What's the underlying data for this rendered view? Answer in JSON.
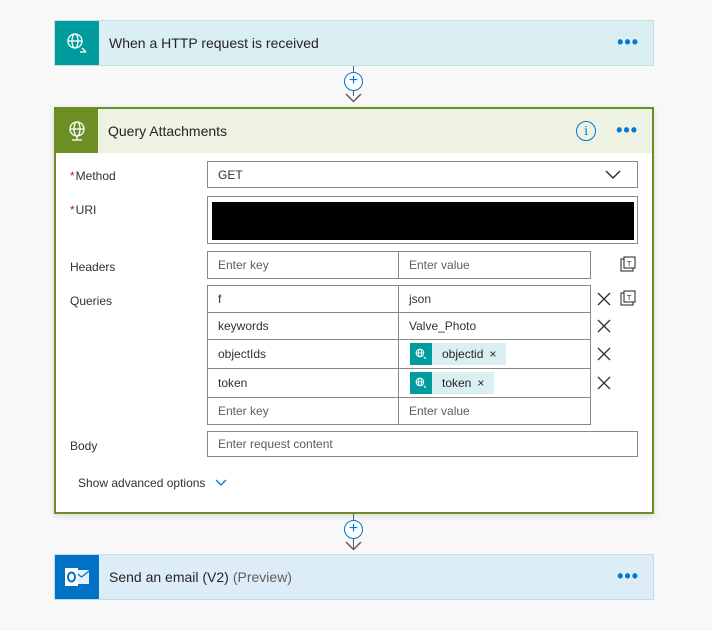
{
  "trigger": {
    "title": "When a HTTP request is received",
    "icon": "globe-http-icon",
    "color": "#009b9c",
    "more": "•••"
  },
  "action": {
    "title": "Query Attachments",
    "icon": "globe-http-icon",
    "color": "#6c8f25",
    "info": "i",
    "more": "•••",
    "method": {
      "label": "Method",
      "required": "*",
      "value": "GET"
    },
    "uri": {
      "label": "URI",
      "required": "*"
    },
    "headers": {
      "label": "Headers",
      "key_placeholder": "Enter key",
      "value_placeholder": "Enter value"
    },
    "queries": {
      "label": "Queries",
      "rows": [
        {
          "key": "f",
          "value": "json"
        },
        {
          "key": "keywords",
          "value": "Valve_Photo"
        },
        {
          "key": "objectIds",
          "token": "objectid"
        },
        {
          "key": "token",
          "token": "token"
        }
      ],
      "key_placeholder": "Enter key",
      "value_placeholder": "Enter value"
    },
    "body": {
      "label": "Body",
      "placeholder": "Enter request content"
    },
    "advanced": "Show advanced options"
  },
  "email": {
    "title": "Send an email (V2)",
    "suffix": "(Preview)",
    "icon": "outlook-icon",
    "color": "#0072c6",
    "more": "•••"
  },
  "connector": {
    "plus": "+"
  },
  "token_close": "×"
}
